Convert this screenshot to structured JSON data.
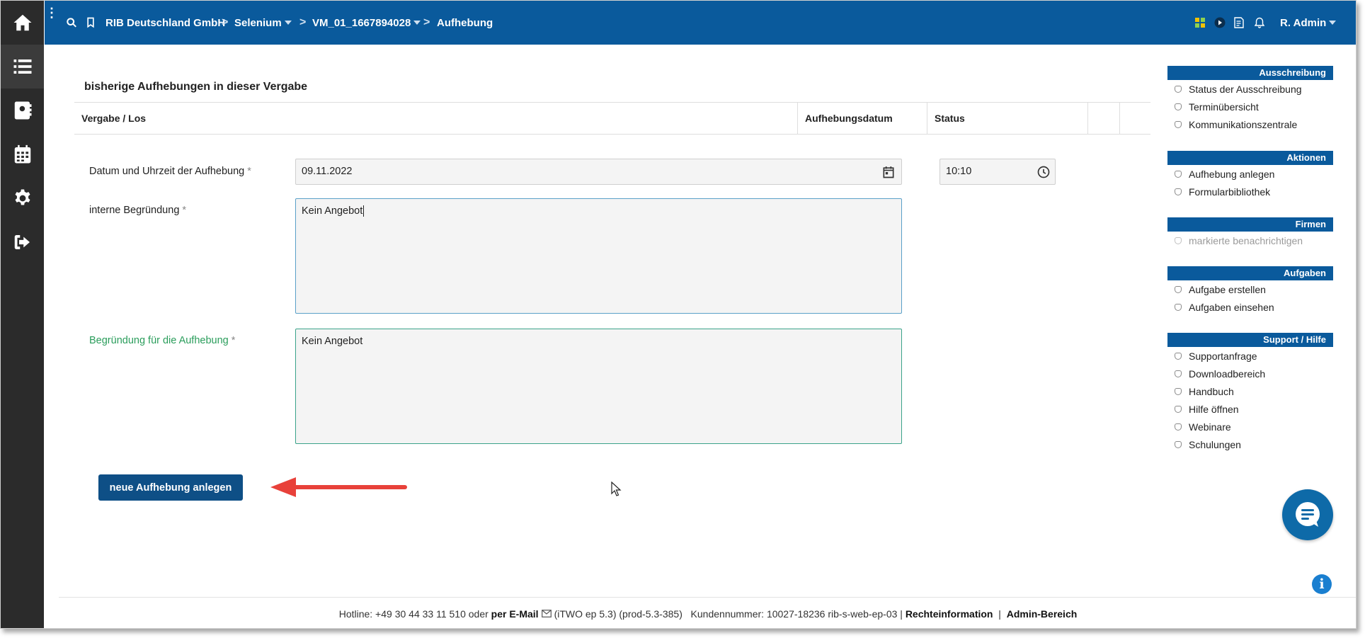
{
  "topbar": {
    "breadcrumb": {
      "company": "RIB Deutschland GmbH",
      "project": "Selenium",
      "vergabe": "VM_01_1667894028",
      "current": "Aufhebung"
    },
    "user": "R. Admin",
    "brand_color": "#0a5a9c"
  },
  "rail": {
    "items": [
      "home-icon",
      "list-icon",
      "contacts-icon",
      "calendar-icon",
      "gear-icon",
      "logout-icon"
    ]
  },
  "main": {
    "section_title": "bisherige Aufhebungen in dieser Vergabe",
    "table": {
      "columns": [
        "Vergabe / Los",
        "Aufhebungsdatum",
        "Status",
        "",
        ""
      ]
    },
    "form": {
      "datetime_label": "Datum und Uhrzeit der Aufhebung",
      "date_value": "09.11.2022",
      "time_value": "10:10",
      "internal_reason_label": "interne Begründung",
      "internal_reason_value": "Kein Angebot",
      "reason_label": "Begründung für die Aufhebung",
      "reason_value": "Kein Angebot",
      "required_mark": "*",
      "submit_label": "neue Aufhebung anlegen"
    }
  },
  "sidebar": {
    "groups": [
      {
        "title": "Ausschreibung",
        "items": [
          "Status der Ausschreibung",
          "Terminübersicht",
          "Kommunikationszentrale"
        ]
      },
      {
        "title": "Aktionen",
        "items": [
          "Aufhebung anlegen",
          "Formularbibliothek"
        ]
      },
      {
        "title": "Firmen",
        "items": [
          "markierte benachrichtigen"
        ]
      },
      {
        "title": "Aufgaben",
        "items": [
          "Aufgabe erstellen",
          "Aufgaben einsehen"
        ]
      },
      {
        "title": "Support / Hilfe",
        "items": [
          "Supportanfrage",
          "Downloadbereich",
          "Handbuch",
          "Hilfe öffnen",
          "Webinare",
          "Schulungen"
        ]
      }
    ]
  },
  "footer": {
    "hotline": "Hotline: +49 30 44 33 11 510 oder",
    "email_link": "per E-Mail",
    "version": "(iTWO ep 5.3) (prod-5.3-385)",
    "customer": "Kundennummer: 10027-18236 rib-s-web-ep-03 |",
    "legal_link": "Rechteinformation",
    "separator": "|",
    "admin_link": "Admin-Bereich"
  }
}
